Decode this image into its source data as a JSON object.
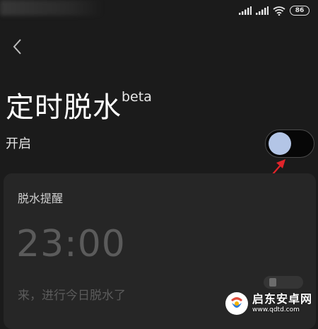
{
  "status_bar": {
    "battery": "86",
    "icons": [
      "signal-icon",
      "signal-icon",
      "wifi-icon",
      "battery-icon"
    ]
  },
  "header": {
    "back_icon": "chevron-left-icon"
  },
  "feature": {
    "title": "定时脱水",
    "title_sup": "beta",
    "toggle_label": "开启",
    "toggle_on": false,
    "accent": "#b3c5e6"
  },
  "annotation": {
    "arrow_color": "#e0242a"
  },
  "reminder_card": {
    "title": "脱水提醒",
    "time": "23:00",
    "message": "来，进行今日脱水了"
  },
  "watermark": {
    "name": "启东安卓网",
    "url": "www.qdtd.com"
  }
}
